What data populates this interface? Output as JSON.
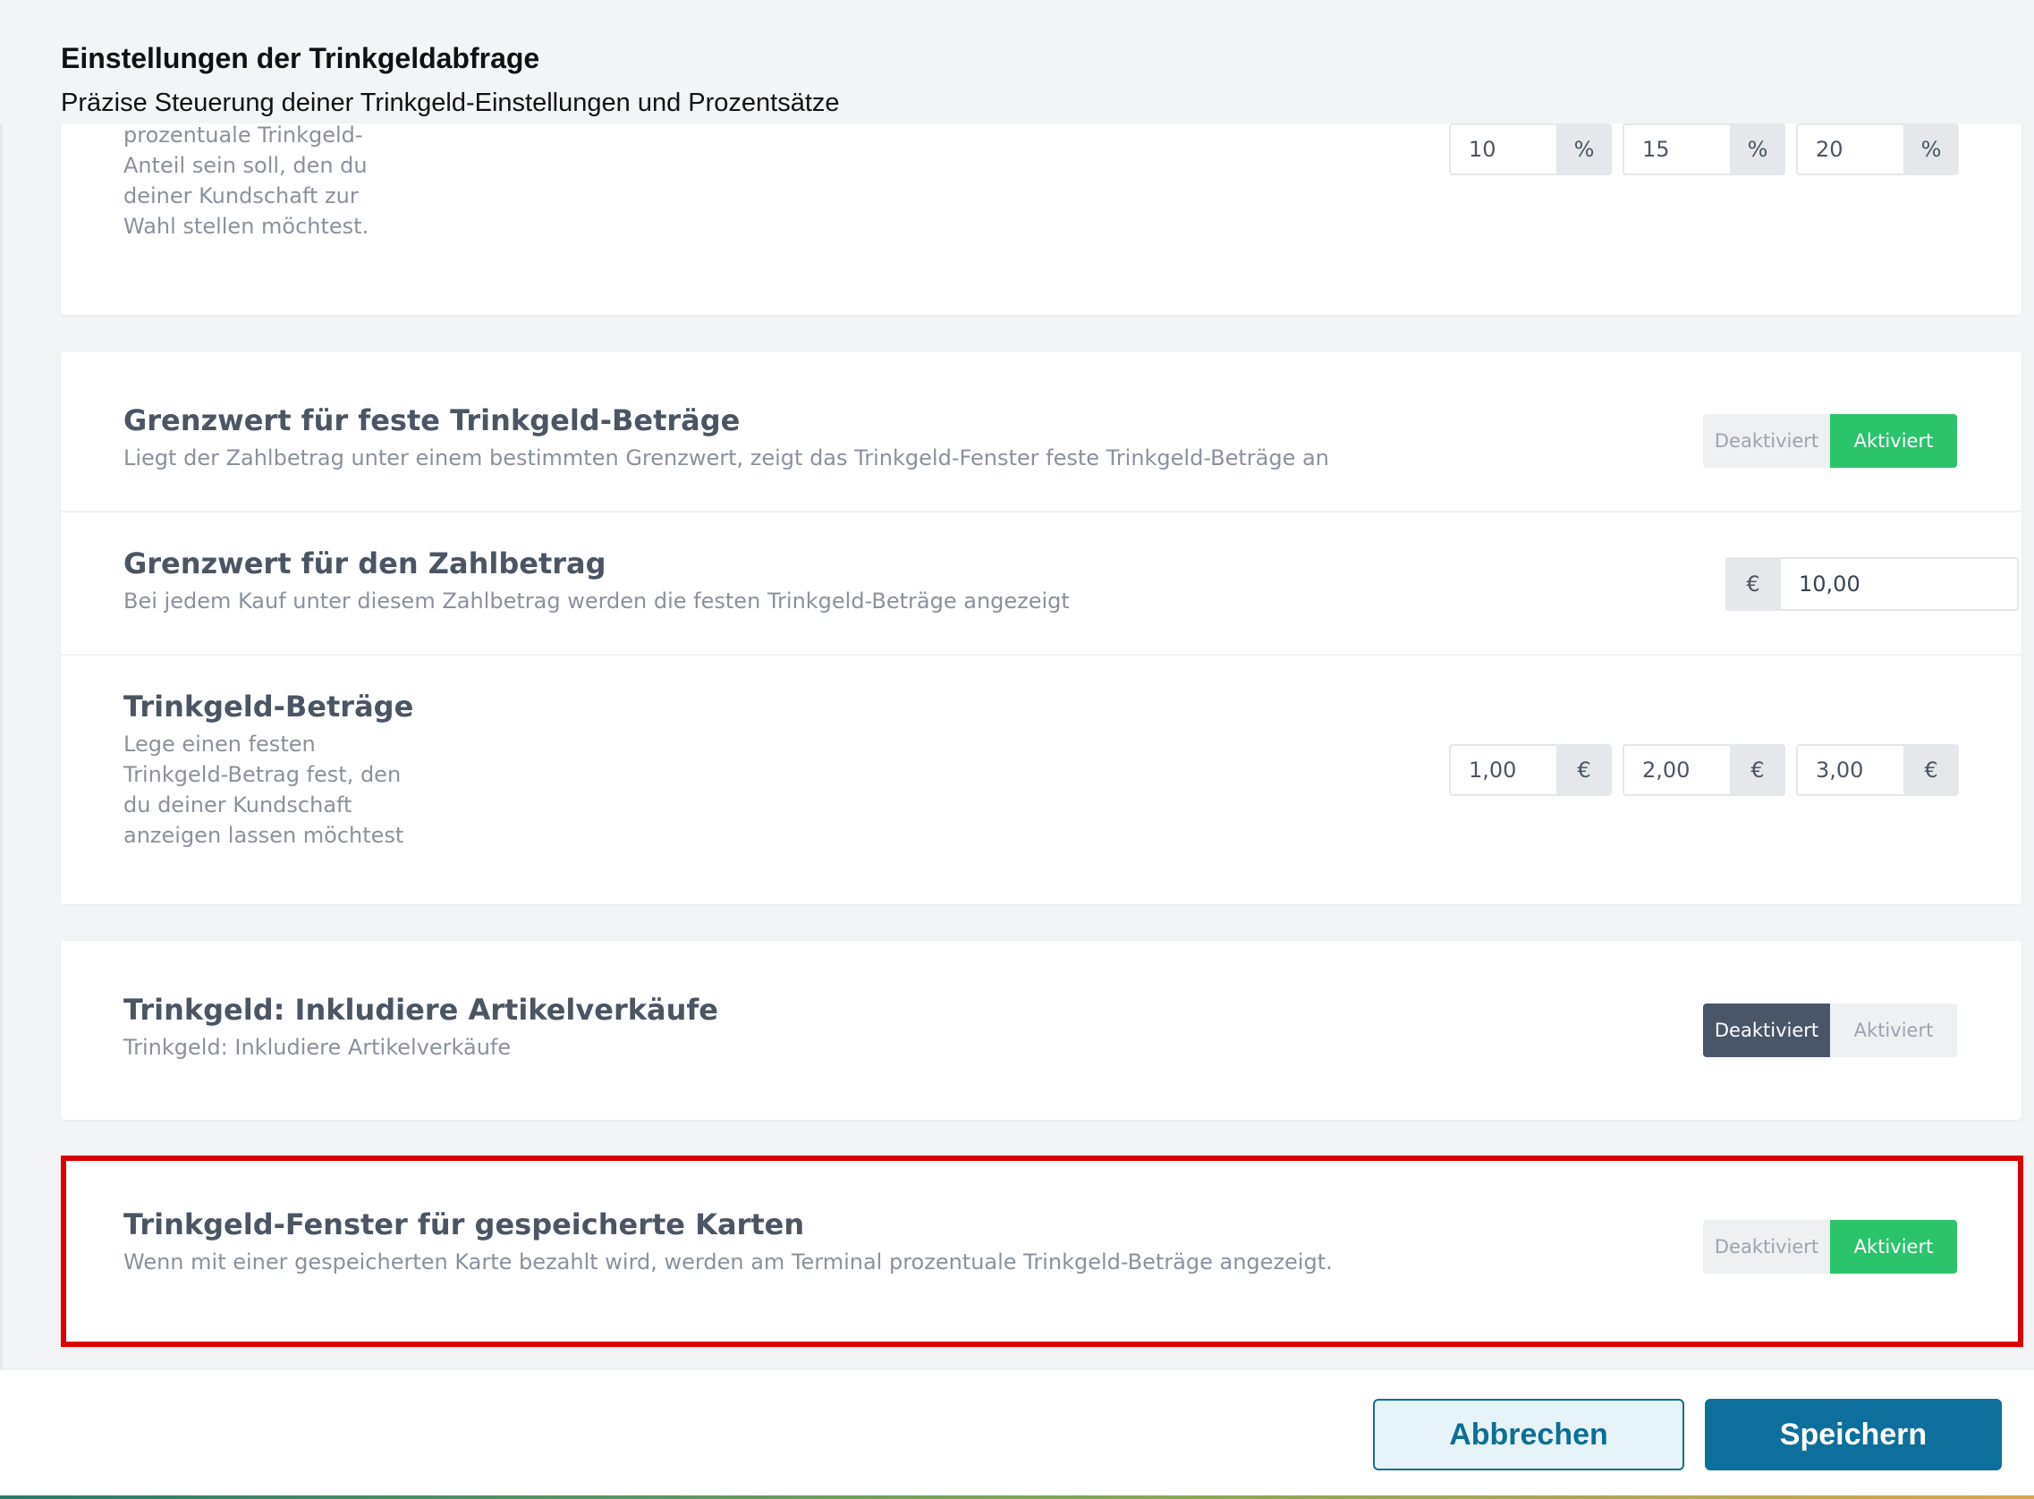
{
  "header": {
    "title": "Einstellungen der Trinkgeldabfrage",
    "subtitle": "Präzise Steuerung deiner Trinkgeld-Einstellungen und Prozentsätze"
  },
  "percent_section": {
    "description": "Lege fest, wie groß der prozentuale Trinkgeld-Anteil sein soll, den du deiner Kundschaft zur Wahl stellen möchtest.",
    "values": [
      "10",
      "15",
      "20"
    ],
    "unit": "%"
  },
  "threshold_fixed": {
    "title": "Grenzwert für feste Trinkgeld-Beträge",
    "description": "Liegt der Zahlbetrag unter einem bestimmten Grenzwert, zeigt das Trinkgeld-Fenster feste Trinkgeld-Beträge an",
    "toggle": {
      "off_label": "Deaktiviert",
      "on_label": "Aktiviert",
      "selected": "Aktiviert"
    }
  },
  "threshold_amount": {
    "title": "Grenzwert für den Zahlbetrag",
    "description": "Bei jedem Kauf unter diesem Zahlbetrag werden die festen Trinkgeld-Beträge angezeigt",
    "currency": "€",
    "value": "10,00"
  },
  "tip_amounts": {
    "title": "Trinkgeld-Beträge",
    "description": "Lege einen festen Trinkgeld-Betrag fest, den du deiner Kundschaft anzeigen lassen möchtest",
    "values": [
      "1,00",
      "2,00",
      "3,00"
    ],
    "unit": "€"
  },
  "include_items": {
    "title": "Trinkgeld: Inkludiere Artikelverkäufe",
    "description": "Trinkgeld: Inkludiere Artikelverkäufe",
    "toggle": {
      "off_label": "Deaktiviert",
      "on_label": "Aktiviert",
      "selected": "Deaktiviert"
    }
  },
  "saved_cards": {
    "title": "Trinkgeld-Fenster für gespeicherte Karten",
    "description": "Wenn mit einer gespeicherten Karte bezahlt wird, werden am Terminal prozentuale Trinkgeld-Beträge angezeigt.",
    "toggle": {
      "off_label": "Deaktiviert",
      "on_label": "Aktiviert",
      "selected": "Aktiviert"
    }
  },
  "footer": {
    "cancel_label": "Abbrechen",
    "save_label": "Speichern"
  },
  "colors": {
    "active_green": "#2bc46b",
    "active_dark": "#4a5568",
    "primary": "#0d6f9b",
    "highlight": "#dc0000"
  }
}
